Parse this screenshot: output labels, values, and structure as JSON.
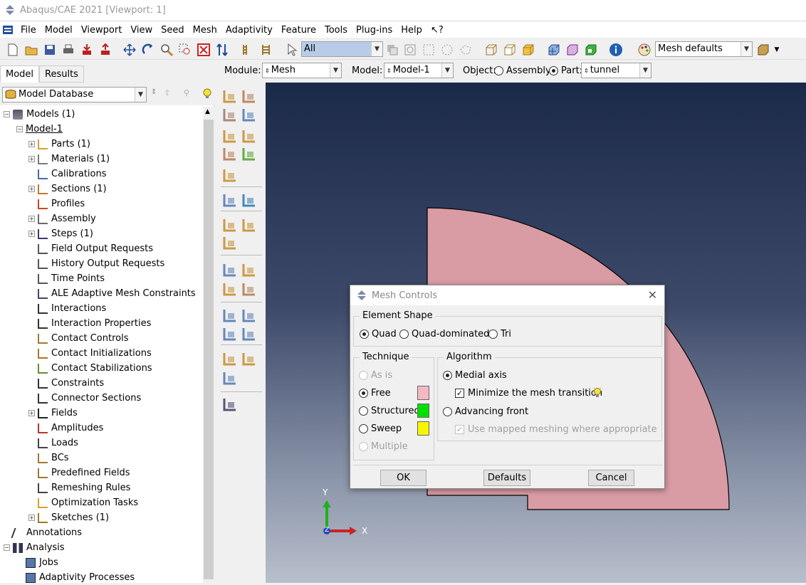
{
  "window": {
    "title": "Abaqus/CAE 2021 [Viewport: 1]"
  },
  "menu": [
    "File",
    "Model",
    "Viewport",
    "View",
    "Seed",
    "Mesh",
    "Adaptivity",
    "Feature",
    "Tools",
    "Plug-ins",
    "Help",
    "↖?"
  ],
  "toolbar": {
    "selection_filter": "All",
    "mesh_defaults": "Mesh defaults"
  },
  "context": {
    "module_label": "Module:",
    "module_value": "Mesh",
    "model_label": "Model:",
    "model_value": "Model-1",
    "object_label": "Object:",
    "assembly_label": "Assembly",
    "part_label": "Part:",
    "part_value": "tunnel"
  },
  "tabs": {
    "model": "Model",
    "results": "Results"
  },
  "database": {
    "label": "Model Database"
  },
  "tree": {
    "models": "Models (1)",
    "model1": "Model-1",
    "items": [
      "Parts (1)",
      "Materials (1)",
      "Calibrations",
      "Sections (1)",
      "Profiles",
      "Assembly",
      "Steps (1)",
      "Field Output Requests",
      "History Output Requests",
      "Time Points",
      "ALE Adaptive Mesh Constraints",
      "Interactions",
      "Interaction Properties",
      "Contact Controls",
      "Contact Initializations",
      "Contact Stabilizations",
      "Constraints",
      "Connector Sections",
      "Fields",
      "Amplitudes",
      "Loads",
      "BCs",
      "Predefined Fields",
      "Remeshing Rules",
      "Optimization Tasks",
      "Sketches (1)"
    ],
    "annotations": "Annotations",
    "analysis": "Analysis",
    "jobs": "Jobs",
    "adaptivity": "Adaptivity Processes"
  },
  "dialog": {
    "title": "Mesh Controls",
    "element_shape": "Element Shape",
    "quad": "Quad",
    "quad_dominated": "Quad-dominated",
    "tri": "Tri",
    "technique": "Technique",
    "as_is": "As is",
    "free": "Free",
    "structured": "Structured",
    "sweep": "Sweep",
    "multiple": "Multiple",
    "algorithm": "Algorithm",
    "medial_axis": "Medial axis",
    "minimize": "Minimize the mesh transition",
    "advancing_front": "Advancing front",
    "use_mapped": "Use mapped meshing where appropriate",
    "ok": "OK",
    "defaults": "Defaults",
    "cancel": "Cancel",
    "colors": {
      "free": "#f6b9c4",
      "structured": "#00e000",
      "sweep": "#f6f600"
    }
  },
  "triad": {
    "x": "X",
    "y": "Y",
    "z": "Z"
  },
  "part_color": "#d99ba4"
}
